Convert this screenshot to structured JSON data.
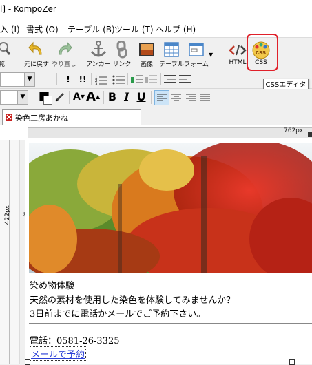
{
  "window": {
    "title": "l] - KompoZer"
  },
  "menu": [
    "入 (I)",
    "書式 (O)",
    "テーブル (B)",
    "ツール (T)",
    "ヘルプ (H)"
  ],
  "toolbar": {
    "items": [
      {
        "label": "覧",
        "icon": "magnifier-icon"
      },
      {
        "label": "元に戻す",
        "icon": "undo-arrow-icon"
      },
      {
        "label": "やり直し",
        "icon": "redo-arrow-icon"
      },
      {
        "label": "アンカー",
        "icon": "anchor-icon"
      },
      {
        "label": "リンク",
        "icon": "chain-link-icon"
      },
      {
        "label": "画像",
        "icon": "picture-icon"
      },
      {
        "label": "テーブル",
        "icon": "table-icon"
      },
      {
        "label": "フォーム",
        "icon": "form-icon"
      },
      {
        "label": "HTML",
        "icon": "html-tag-icon"
      },
      {
        "label": "CSS",
        "icon": "css-palette-icon"
      }
    ]
  },
  "tooltip": {
    "text": "CSSエディタ"
  },
  "format_buttons": {
    "bold": "B",
    "italic": "I",
    "underline": "U",
    "font_smaller": "A",
    "font_larger": "A"
  },
  "tab": {
    "label": "染色工房あかね"
  },
  "ruler": {
    "width_label": "762px",
    "height_label": "422px"
  },
  "content": {
    "title_line": "染め物体験",
    "line2": "天然の素材を使用した染色を体験してみませんか？",
    "line3": "3日前までに電話かメールでご予約下さい。",
    "phone": "電話：0581-26-3325",
    "mail_link": "メールで予約"
  },
  "colors": {
    "highlight": "#e0202a",
    "link": "#2b3fd6",
    "accent_blue": "#2a6fdb"
  }
}
